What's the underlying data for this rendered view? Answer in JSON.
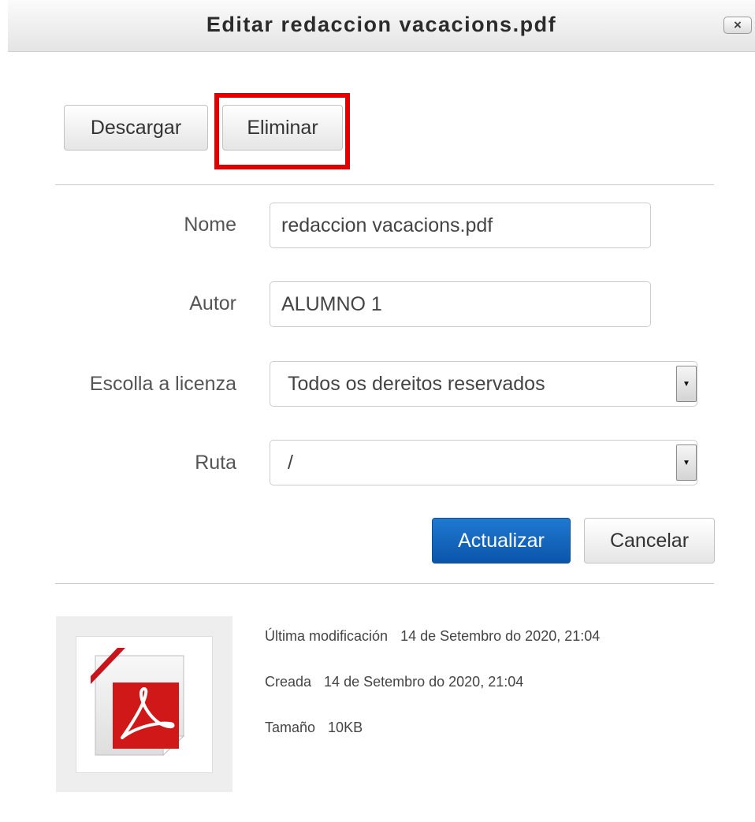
{
  "dialog": {
    "title": "Editar redaccion vacacions.pdf",
    "close_label": "×"
  },
  "actions": {
    "download_label": "Descargar",
    "delete_label": "Eliminar"
  },
  "form": {
    "name_label": "Nome",
    "name_value": "redaccion vacacions.pdf",
    "author_label": "Autor",
    "author_value": "ALUMNO 1",
    "license_label": "Escolla a licenza",
    "license_value": "Todos os dereitos reservados",
    "path_label": "Ruta",
    "path_value": "/",
    "update_label": "Actualizar",
    "cancel_label": "Cancelar"
  },
  "file_info": {
    "modified_label": "Última modificación",
    "modified_value": "14 de Setembro do 2020, 21:04",
    "created_label": "Creada",
    "created_value": "14 de Setembro do 2020, 21:04",
    "size_label": "Tamaño",
    "size_value": "10KB"
  },
  "icons": {
    "close": "close-icon",
    "select_arrow": "chevron-down-icon",
    "file": "pdf-file-icon"
  },
  "colors": {
    "primary_button": "#0a55ab",
    "highlight": "#e00000",
    "pdf_red": "#d01818"
  }
}
